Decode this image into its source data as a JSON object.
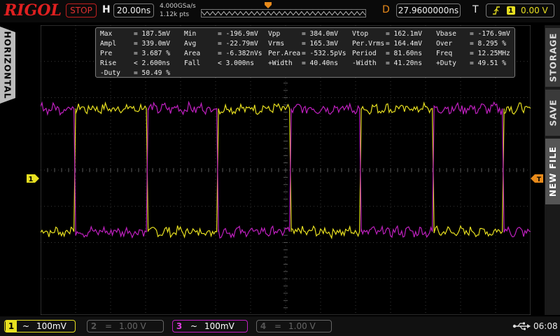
{
  "top": {
    "logo": "RIGOL",
    "run_state": "STOP",
    "time_label": "H",
    "time_scale": "20.00ns",
    "sample_rate": "4.000GSa/s",
    "memory_depth": "1.12k pts",
    "delay_label": "D",
    "delay": "27.9600000ns",
    "trigger_label": "T",
    "trigger_source": "1",
    "trigger_level": "0.00 V"
  },
  "side_tabs": {
    "left": "HORIZONTAL",
    "storage": "STORAGE",
    "save": "SAVE",
    "new_file": "NEW FILE"
  },
  "markers": {
    "ch1": "1",
    "trigger": "T"
  },
  "measurements": [
    [
      [
        "Max",
        "= 187.5mV"
      ],
      [
        "Min",
        "= -196.9mV"
      ],
      [
        "Vpp",
        "= 384.0mV"
      ],
      [
        "Vtop",
        "= 162.1mV"
      ],
      [
        "Vbase",
        "= -176.9mV"
      ]
    ],
    [
      [
        "Ampl",
        "= 339.0mV"
      ],
      [
        "Avg",
        "= -22.79mV"
      ],
      [
        "Vrms",
        "= 165.3mV"
      ],
      [
        "Per.Vrms",
        "= 164.4mV"
      ],
      [
        "Over",
        "= 8.295 %"
      ]
    ],
    [
      [
        "Pre",
        "= 3.687 %"
      ],
      [
        "Area",
        "= -6.382nVs"
      ],
      [
        "Per.Area",
        "= -532.5pVs"
      ],
      [
        "Period",
        "= 81.60ns"
      ],
      [
        "Freq",
        "= 12.25MHz"
      ]
    ],
    [
      [
        "Rise",
        "< 2.600ns"
      ],
      [
        "Fall",
        "< 3.000ns"
      ],
      [
        "+Width",
        "= 40.40ns"
      ],
      [
        "-Width",
        "= 41.20ns"
      ],
      [
        "+Duty",
        "= 49.51 %"
      ]
    ],
    [
      [
        "-Duty",
        "= 50.49 %"
      ]
    ]
  ],
  "channels": [
    {
      "num": "1",
      "coupling": "~",
      "scale": "100mV"
    },
    {
      "num": "2",
      "coupling": "=",
      "scale": "1.00 V"
    },
    {
      "num": "3",
      "coupling": "~",
      "scale": "100mV"
    },
    {
      "num": "4",
      "coupling": "=",
      "scale": "1.00 V"
    }
  ],
  "status": {
    "clock": "06:08"
  },
  "colors": {
    "ch1": "#e8e020",
    "ch3": "#c020c0",
    "accent": "#e88a1a",
    "logo": "#e02020"
  },
  "chart_data": {
    "type": "line",
    "x_unit": "ns",
    "y_unit": "mV",
    "xlim": [
      -112.04,
      167.96
    ],
    "ylim": [
      -400,
      400
    ],
    "series": [
      {
        "points": [
          [
            -112.04,
            -170
          ],
          [
            -93,
            -170
          ],
          [
            -92,
            170
          ],
          [
            -51.6,
            170
          ],
          [
            -50.6,
            -170
          ],
          [
            -11.4,
            -170
          ],
          [
            -10.4,
            170
          ],
          [
            30.2,
            170
          ],
          [
            31.2,
            -170
          ],
          [
            70.2,
            -170
          ],
          [
            71.2,
            170
          ],
          [
            111.8,
            170
          ],
          [
            112.8,
            -170
          ],
          [
            151.8,
            -170
          ],
          [
            152.8,
            170
          ],
          [
            167.96,
            170
          ]
        ]
      },
      {
        "points": [
          [
            -112.04,
            170
          ],
          [
            -93,
            170
          ],
          [
            -92,
            -170
          ],
          [
            -51.6,
            -170
          ],
          [
            -50.6,
            170
          ],
          [
            -11.4,
            170
          ],
          [
            -10.4,
            -170
          ],
          [
            30.2,
            -170
          ],
          [
            31.2,
            170
          ],
          [
            70.2,
            170
          ],
          [
            71.2,
            -170
          ],
          [
            111.8,
            -170
          ],
          [
            112.8,
            170
          ],
          [
            151.8,
            170
          ],
          [
            152.8,
            -170
          ],
          [
            167.96,
            -170
          ]
        ]
      }
    ]
  }
}
